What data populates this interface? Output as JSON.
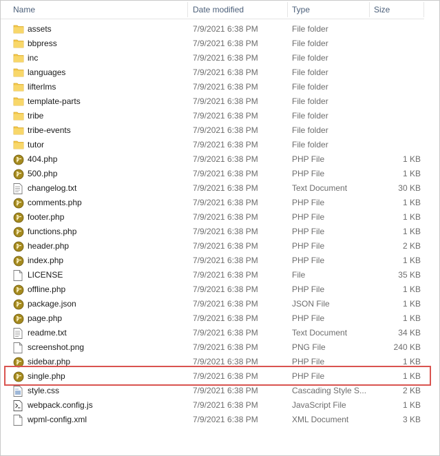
{
  "columns": {
    "name": "Name",
    "date": "Date modified",
    "type": "Type",
    "size": "Size"
  },
  "files": [
    {
      "name": "assets",
      "date": "7/9/2021 6:38 PM",
      "type": "File folder",
      "size": "",
      "icon": "folder-icon"
    },
    {
      "name": "bbpress",
      "date": "7/9/2021 6:38 PM",
      "type": "File folder",
      "size": "",
      "icon": "folder-icon"
    },
    {
      "name": "inc",
      "date": "7/9/2021 6:38 PM",
      "type": "File folder",
      "size": "",
      "icon": "folder-icon"
    },
    {
      "name": "languages",
      "date": "7/9/2021 6:38 PM",
      "type": "File folder",
      "size": "",
      "icon": "folder-icon"
    },
    {
      "name": "lifterlms",
      "date": "7/9/2021 6:38 PM",
      "type": "File folder",
      "size": "",
      "icon": "folder-icon"
    },
    {
      "name": "template-parts",
      "date": "7/9/2021 6:38 PM",
      "type": "File folder",
      "size": "",
      "icon": "folder-icon"
    },
    {
      "name": "tribe",
      "date": "7/9/2021 6:38 PM",
      "type": "File folder",
      "size": "",
      "icon": "folder-icon"
    },
    {
      "name": "tribe-events",
      "date": "7/9/2021 6:38 PM",
      "type": "File folder",
      "size": "",
      "icon": "folder-icon"
    },
    {
      "name": "tutor",
      "date": "7/9/2021 6:38 PM",
      "type": "File folder",
      "size": "",
      "icon": "folder-icon"
    },
    {
      "name": "404.php",
      "date": "7/9/2021 6:38 PM",
      "type": "PHP File",
      "size": "1 KB",
      "icon": "php-file-icon"
    },
    {
      "name": "500.php",
      "date": "7/9/2021 6:38 PM",
      "type": "PHP File",
      "size": "1 KB",
      "icon": "php-file-icon"
    },
    {
      "name": "changelog.txt",
      "date": "7/9/2021 6:38 PM",
      "type": "Text Document",
      "size": "30 KB",
      "icon": "text-file-icon"
    },
    {
      "name": "comments.php",
      "date": "7/9/2021 6:38 PM",
      "type": "PHP File",
      "size": "1 KB",
      "icon": "php-file-icon"
    },
    {
      "name": "footer.php",
      "date": "7/9/2021 6:38 PM",
      "type": "PHP File",
      "size": "1 KB",
      "icon": "php-file-icon"
    },
    {
      "name": "functions.php",
      "date": "7/9/2021 6:38 PM",
      "type": "PHP File",
      "size": "1 KB",
      "icon": "php-file-icon"
    },
    {
      "name": "header.php",
      "date": "7/9/2021 6:38 PM",
      "type": "PHP File",
      "size": "2 KB",
      "icon": "php-file-icon"
    },
    {
      "name": "index.php",
      "date": "7/9/2021 6:38 PM",
      "type": "PHP File",
      "size": "1 KB",
      "icon": "php-file-icon"
    },
    {
      "name": "LICENSE",
      "date": "7/9/2021 6:38 PM",
      "type": "File",
      "size": "35 KB",
      "icon": "blank-file-icon"
    },
    {
      "name": "offline.php",
      "date": "7/9/2021 6:38 PM",
      "type": "PHP File",
      "size": "1 KB",
      "icon": "php-file-icon"
    },
    {
      "name": "package.json",
      "date": "7/9/2021 6:38 PM",
      "type": "JSON File",
      "size": "1 KB",
      "icon": "php-file-icon"
    },
    {
      "name": "page.php",
      "date": "7/9/2021 6:38 PM",
      "type": "PHP File",
      "size": "1 KB",
      "icon": "php-file-icon"
    },
    {
      "name": "readme.txt",
      "date": "7/9/2021 6:38 PM",
      "type": "Text Document",
      "size": "34 KB",
      "icon": "text-file-icon"
    },
    {
      "name": "screenshot.png",
      "date": "7/9/2021 6:38 PM",
      "type": "PNG File",
      "size": "240 KB",
      "icon": "blank-file-icon"
    },
    {
      "name": "sidebar.php",
      "date": "7/9/2021 6:38 PM",
      "type": "PHP File",
      "size": "1 KB",
      "icon": "php-file-icon"
    },
    {
      "name": "single.php",
      "date": "7/9/2021 6:38 PM",
      "type": "PHP File",
      "size": "1 KB",
      "icon": "php-file-icon",
      "highlighted": true
    },
    {
      "name": "style.css",
      "date": "7/9/2021 6:38 PM",
      "type": "Cascading Style S...",
      "size": "2 KB",
      "icon": "css-file-icon"
    },
    {
      "name": "webpack.config.js",
      "date": "7/9/2021 6:38 PM",
      "type": "JavaScript File",
      "size": "1 KB",
      "icon": "script-file-icon"
    },
    {
      "name": "wpml-config.xml",
      "date": "7/9/2021 6:38 PM",
      "type": "XML Document",
      "size": "3 KB",
      "icon": "blank-file-icon"
    }
  ],
  "colors": {
    "highlight_border": "#d9534f",
    "header_text": "#4c607a",
    "folder": "#f3c74b",
    "php": "#a58a1f"
  }
}
